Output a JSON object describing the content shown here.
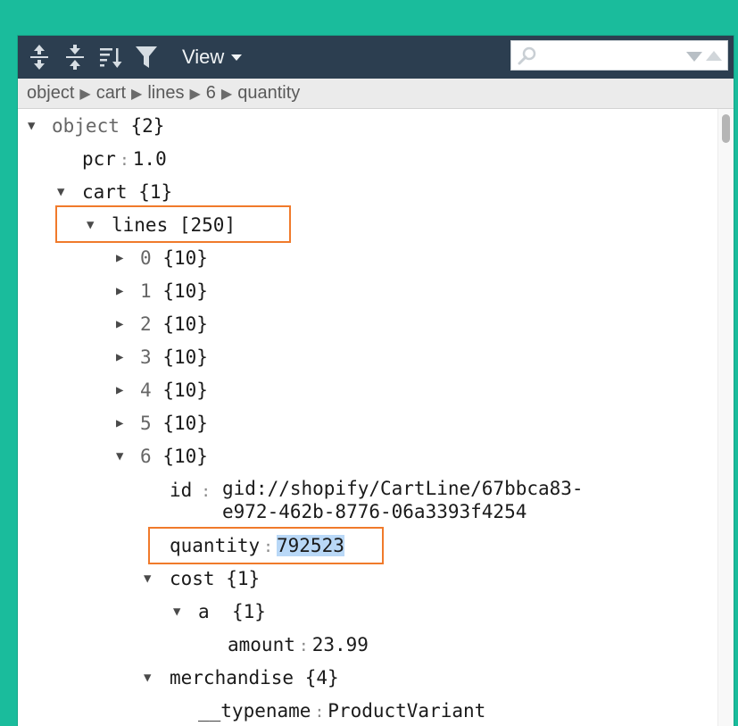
{
  "toolbar": {
    "icons": [
      "expand-all-icon",
      "collapse-all-icon",
      "sort-icon",
      "filter-icon"
    ],
    "view_label": "View",
    "search_placeholder": "",
    "bg_color": "#2c3e50"
  },
  "breadcrumb": [
    "object",
    "cart",
    "lines",
    "6",
    "quantity"
  ],
  "tree": {
    "root_key": "object",
    "root_count": "{2}",
    "pcr_key": "pcr",
    "pcr_value": "1.0",
    "cart_key": "cart",
    "cart_count": "{1}",
    "lines_key": "lines",
    "lines_count": "[250]",
    "line_items": [
      {
        "index": "0",
        "count": "{10}"
      },
      {
        "index": "1",
        "count": "{10}"
      },
      {
        "index": "2",
        "count": "{10}"
      },
      {
        "index": "3",
        "count": "{10}"
      },
      {
        "index": "4",
        "count": "{10}"
      },
      {
        "index": "5",
        "count": "{10}"
      },
      {
        "index": "6",
        "count": "{10}"
      }
    ],
    "id_key": "id",
    "id_value_line1": "gid://shopify/CartLine/67bbca83-",
    "id_value_line2": "e972-462b-8776-06a3393f4254",
    "quantity_key": "quantity",
    "quantity_value": "792523",
    "cost_key": "cost",
    "cost_count": "{1}",
    "a_key": "a",
    "a_count": "{1}",
    "amount_key": "amount",
    "amount_value": "23.99",
    "merchandise_key": "merchandise",
    "merchandise_count": "{4}",
    "typename_key": "__typename",
    "typename_value": "ProductVariant"
  },
  "colors": {
    "background": "#1abc9c",
    "highlight": "#f07a2b",
    "selection": "#b9d8f7"
  }
}
